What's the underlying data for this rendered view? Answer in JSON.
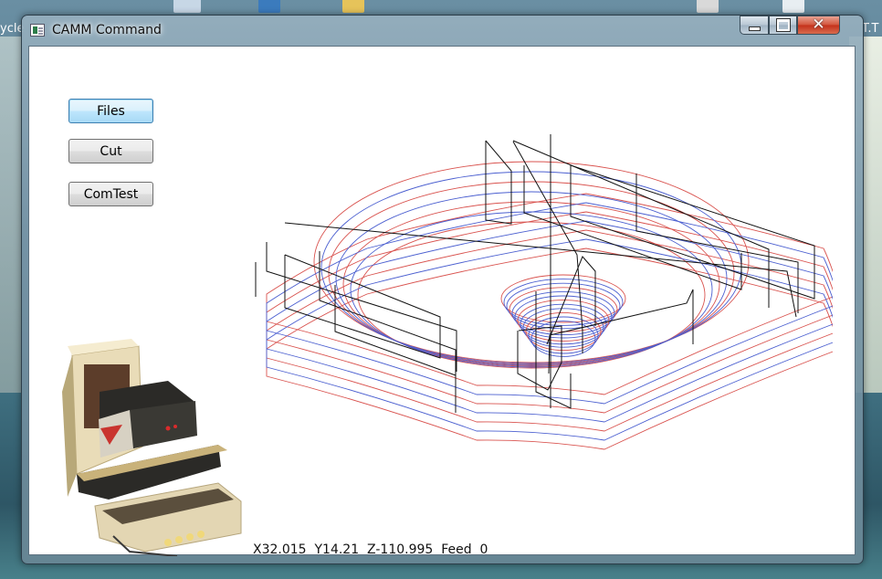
{
  "desktop": {
    "labels": {
      "left": "ycle",
      "right": "T.T"
    }
  },
  "window": {
    "title": "CAMM Command",
    "controls": {
      "minimize_icon": "minimize-icon",
      "maximize_icon": "maximize-icon",
      "close_icon": "close-icon"
    }
  },
  "toolbar": {
    "files_label": "Files",
    "cut_label": "Cut",
    "comtest_label": "ComTest"
  },
  "status": {
    "x": "X32.015",
    "y": "Y14.21",
    "z": "Z-110.995",
    "feed_label": "Feed",
    "feed_value": "0"
  },
  "colors": {
    "path_red": "#d9534f",
    "path_blue": "#4b5fd0",
    "path_black": "#111111"
  }
}
